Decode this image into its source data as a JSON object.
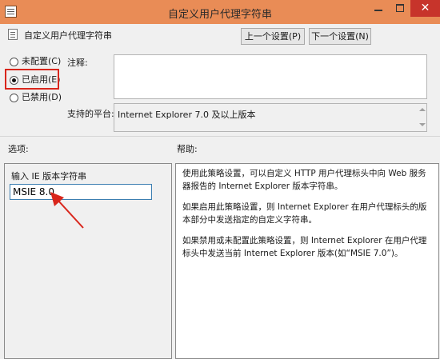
{
  "window": {
    "title": "自定义用户代理字符串",
    "close_glyph": "✕"
  },
  "header": {
    "setting_name": "自定义用户代理字符串",
    "prev_button": "上一个设置(P)",
    "next_button": "下一个设置(N)"
  },
  "state": {
    "options": [
      {
        "label": "未配置(C)",
        "checked": false
      },
      {
        "label": "已启用(E)",
        "checked": true
      },
      {
        "label": "已禁用(D)",
        "checked": false
      }
    ]
  },
  "comment": {
    "label": "注释:",
    "value": ""
  },
  "platform": {
    "label": "支持的平台:",
    "value": "Internet Explorer 7.0 及以上版本"
  },
  "options_pane": {
    "heading": "选项:",
    "field_label": "输入 IE 版本字符串",
    "field_value": "MSIE 8.0"
  },
  "help_pane": {
    "heading": "帮助:",
    "paragraphs": [
      "使用此策略设置，可以自定义 HTTP 用户代理标头中向 Web 服务器报告的 Internet Explorer 版本字符串。",
      "如果启用此策略设置，则 Internet Explorer 在用户代理标头的版本部分中发送指定的自定义字符串。",
      "如果禁用或未配置此策略设置，则 Internet Explorer 在用户代理标头中发送当前 Internet Explorer 版本(如“MSIE 7.0”)。"
    ]
  },
  "annotation": {
    "arrow_color": "#d9261c",
    "box_color": "#d9261c"
  }
}
